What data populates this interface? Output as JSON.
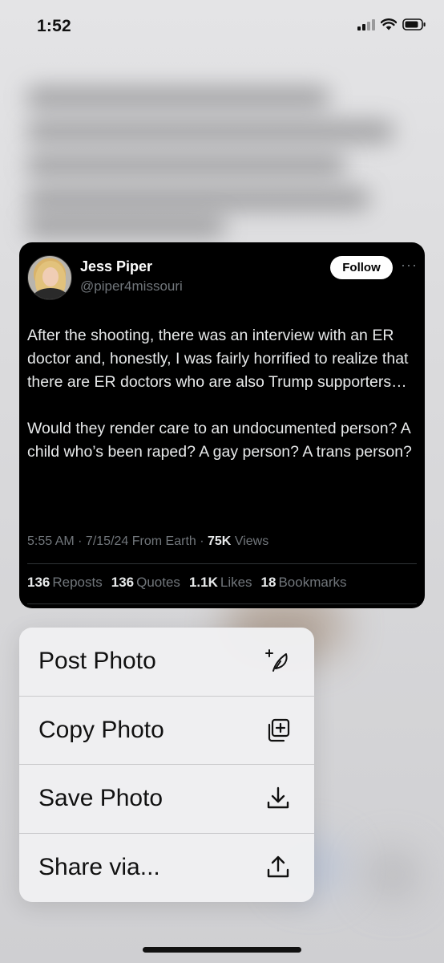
{
  "status_bar": {
    "time": "1:52"
  },
  "tweet": {
    "display_name": "Jess Piper",
    "handle": "@piper4missouri",
    "follow_label": "Follow",
    "more_label": "···",
    "text": "After the shooting, there was an interview with an ER doctor and, honestly, I was fairly horrified to realize that there are ER doctors who are also Trump supporters…\n\nWould they render care to an undocumented person? A child who’s been raped? A gay person? A trans person?",
    "meta": {
      "time": "5:55 AM",
      "date": "7/15/24",
      "source": "From Earth",
      "views_count": "75K",
      "views_label": "Views"
    },
    "stats": [
      {
        "count": "136",
        "label": "Reposts"
      },
      {
        "count": "136",
        "label": "Quotes"
      },
      {
        "count": "1.1K",
        "label": "Likes"
      },
      {
        "count": "18",
        "label": "Bookmarks"
      }
    ]
  },
  "context_menu": {
    "items": [
      {
        "label": "Post Photo",
        "icon": "feather-plus-icon"
      },
      {
        "label": "Copy Photo",
        "icon": "copy-plus-icon"
      },
      {
        "label": "Save Photo",
        "icon": "download-icon"
      },
      {
        "label": "Share via...",
        "icon": "share-icon"
      }
    ]
  }
}
